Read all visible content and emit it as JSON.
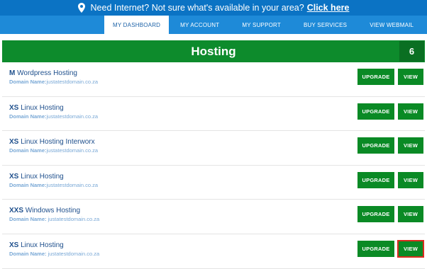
{
  "topbar": {
    "message": "Need Internet? Not sure what's available in your area?",
    "link": "Click here"
  },
  "nav": {
    "items": [
      {
        "label": "MY DASHBOARD",
        "active": true
      },
      {
        "label": "MY ACCOUNT"
      },
      {
        "label": "MY SUPPORT"
      },
      {
        "label": "BUY SERVICES"
      },
      {
        "label": "VIEW WEBMAIL"
      }
    ]
  },
  "section": {
    "title": "Hosting",
    "count": "6"
  },
  "domain_label": "Domain Name:",
  "buttons": {
    "upgrade": "UPGRADE",
    "view": "VIEW"
  },
  "services": [
    {
      "size": "M",
      "name": "Wordpress Hosting",
      "domain": "justatestdomain.co.za"
    },
    {
      "size": "XS",
      "name": "Linux Hosting",
      "domain": "justatestdomain.co.za"
    },
    {
      "size": "XS",
      "name": "Linux Hosting Interworx",
      "domain": "justatestdomain.co.za"
    },
    {
      "size": "XS",
      "name": "Linux Hosting",
      "domain": "justatestdomain.co.za"
    },
    {
      "size": "XXS",
      "name": "Windows Hosting",
      "domain": " justatestdomain.co.za"
    },
    {
      "size": "XS",
      "name": "Linux Hosting",
      "domain": " justatestdomain.co.za"
    }
  ],
  "colors": {
    "topbar": "#0b73c4",
    "nav": "#1e8ad8",
    "header": "#0d8b2c",
    "button": "#0a8a25",
    "highlight": "#d92c1f"
  }
}
